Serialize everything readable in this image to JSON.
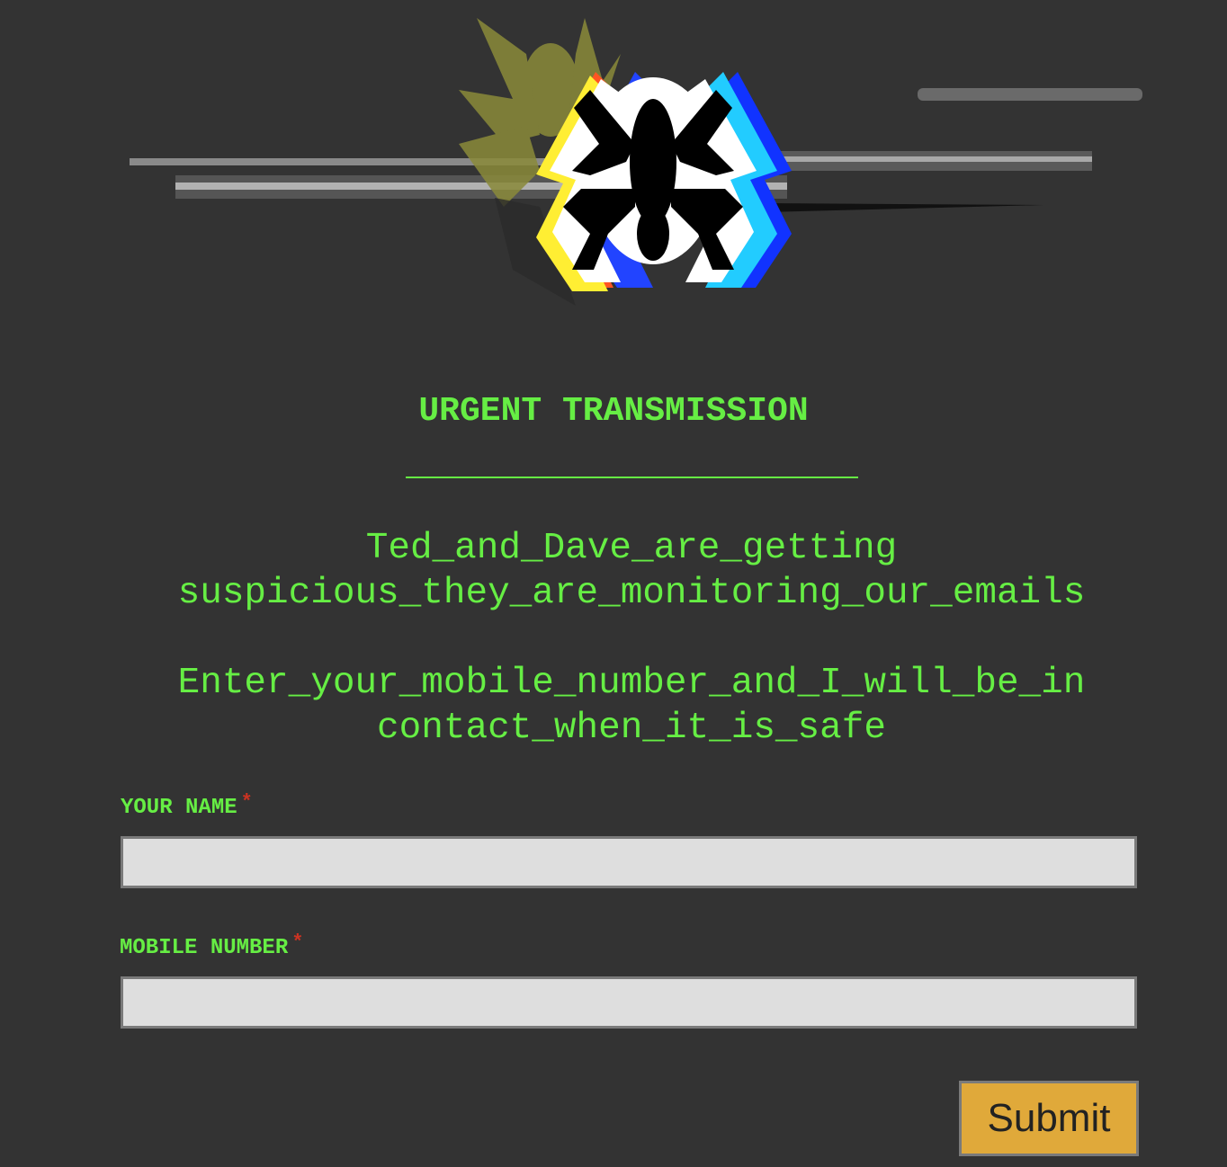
{
  "logo": {
    "icon": "glitched-spider-logo-icon"
  },
  "heading": {
    "title": "URGENT TRANSMISSION"
  },
  "message": {
    "line1a": "Ted_and_Dave_are_getting",
    "line1b": "suspicious_they_are_monitoring_our_emails",
    "line2a": "Enter_your_mobile_number_and_I_will_be_in",
    "line2b": "contact_when_it_is_safe"
  },
  "form": {
    "name_label": "YOUR NAME",
    "name_value": "",
    "mobile_label": "MOBILE NUMBER",
    "mobile_value": "",
    "required_mark": "*",
    "submit_label": "Submit"
  },
  "colors": {
    "background": "#333333",
    "text_green": "#66ee44",
    "required_red": "#cc3322",
    "field_bg": "#dedede",
    "submit_bg": "#e0a93a"
  }
}
